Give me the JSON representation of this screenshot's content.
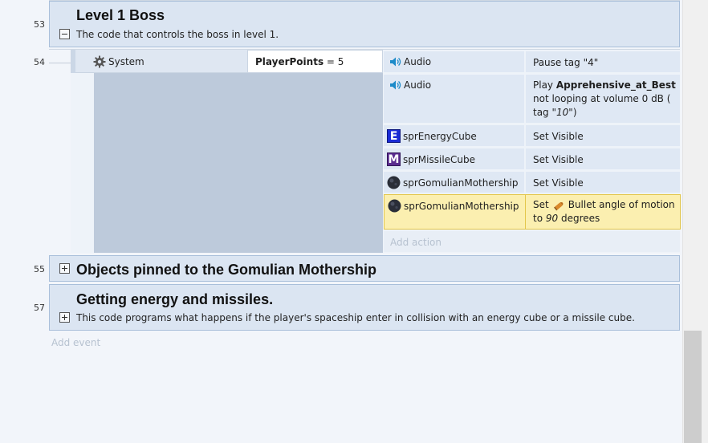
{
  "event_53": {
    "number": "53",
    "title": "Level 1 Boss",
    "description": "The code that controls the boss in level 1."
  },
  "event_54": {
    "number": "54",
    "condition": {
      "object": "System",
      "variable": "PlayerPoints",
      "operator": "= 5"
    },
    "actions": [
      {
        "object": "Audio",
        "icon": "speaker-icon",
        "text": "Pause tag \"4\""
      },
      {
        "object": "Audio",
        "icon": "speaker-icon",
        "play_word": "Play",
        "sound_name": "Apprehensive_at_Best",
        "line2": "not looping at volume 0 dB (",
        "tag_prefix": "tag \"",
        "tag_value": "10",
        "tag_suffix": "\")"
      },
      {
        "object": "sprEnergyCube",
        "icon": "energy-cube-icon",
        "icon_letter": "E",
        "text": "Set Visible"
      },
      {
        "object": "sprMissileCube",
        "icon": "missile-cube-icon",
        "icon_letter": "M",
        "text": "Set Visible"
      },
      {
        "object": "sprGomulianMothership",
        "icon": "mothership-icon",
        "text": "Set Visible"
      },
      {
        "object": "sprGomulianMothership",
        "icon": "mothership-icon",
        "set_word": "Set",
        "behavior": "Bullet angle of motion",
        "to_word": "to",
        "angle": "90",
        "unit": "degrees"
      }
    ],
    "add_action": "Add action"
  },
  "event_55": {
    "number": "55",
    "title": "Objects pinned to the Gomulian Mothership"
  },
  "event_57": {
    "number": "57",
    "title": "Getting energy and missiles.",
    "description": "This code programs what happens if the player's spaceship enter in collision with an energy cube or a missile cube."
  },
  "add_event": "Add event",
  "colors": {
    "group_bg": "#dbe5f2",
    "selected_action": "#fbefb0",
    "selected_border": "#e3c64a",
    "cube_e": "#1a2bd6",
    "cube_m": "#5b2c8f"
  }
}
